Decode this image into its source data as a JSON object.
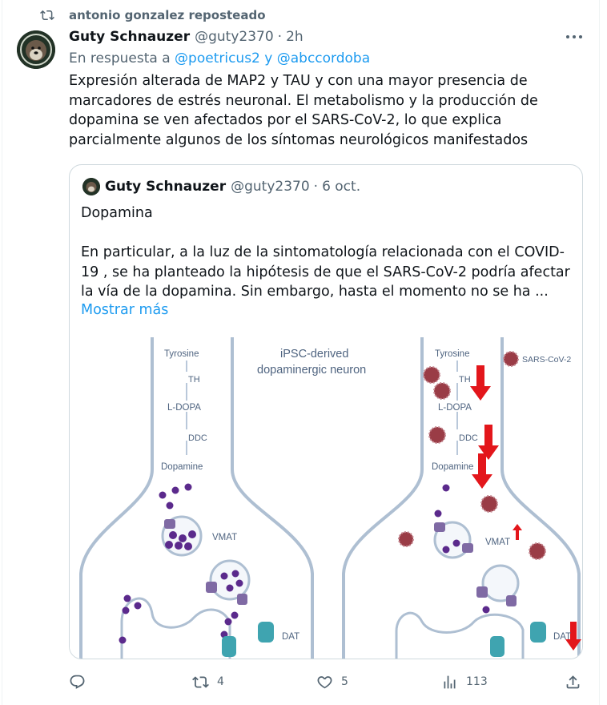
{
  "repost": {
    "text": "antonio gonzalez reposteado",
    "icon": "repost-icon"
  },
  "tweet": {
    "author_name": "Guty Schnauzer",
    "handle": "@guty2370",
    "separator": "·",
    "time": "2h",
    "reply_prefix": "En respuesta a",
    "reply_user1": "@poetricus2",
    "reply_joiner": "y",
    "reply_user2": "@abccordoba",
    "body": "Expresión alterada de MAP2 y TAU y con una mayor presencia de marcadores de estrés neuronal. El metabolismo y la producción de dopamina se ven afectados por el SARS-CoV-2, lo que explica parcialmente algunos de los síntomas neurológicos manifestados"
  },
  "quote": {
    "author_name": "Guty Schnauzer",
    "handle": "@guty2370",
    "separator": "·",
    "date": "6 oct.",
    "paragraph1": "Dopamina",
    "paragraph2": "En particular, a la luz de la sintomatología relacionada con el COVID-19 , se ha planteado la hipótesis de que el SARS-CoV-2 podría afectar la vía de la dopamina. Sin embargo, hasta el momento no se ha ...",
    "show_more": "Mostrar más",
    "figure": {
      "title_line1": "iPSC-derived",
      "title_line2": "dopaminergic neuron",
      "left": {
        "tyrosine": "Tyrosine",
        "th": "TH",
        "ldopa": "L-DOPA",
        "ddc": "DDC",
        "dopamine": "Dopamine",
        "vmat": "VMAT",
        "dat": "DAT"
      },
      "right": {
        "tyrosine": "Tyrosine",
        "th": "TH",
        "ldopa": "L-DOPA",
        "ddc": "DDC",
        "dopamine": "Dopamine",
        "vmat": "VMAT",
        "dat": "DAT",
        "virus_legend": "SARS-CoV-2"
      },
      "colors": {
        "membrane": "#aebfd2",
        "vesicle_dot": "#5b2a8c",
        "virus": "#9a3c46",
        "arrow_down": "#e3161b",
        "transporter": "#3fa4b0"
      }
    }
  },
  "actions": {
    "reply": {
      "icon": "reply-icon",
      "count": ""
    },
    "retweet": {
      "icon": "retweet-icon",
      "count": "4"
    },
    "like": {
      "icon": "heart-icon",
      "count": "5"
    },
    "views": {
      "icon": "views-icon",
      "count": "113"
    },
    "share": {
      "icon": "share-icon"
    }
  }
}
